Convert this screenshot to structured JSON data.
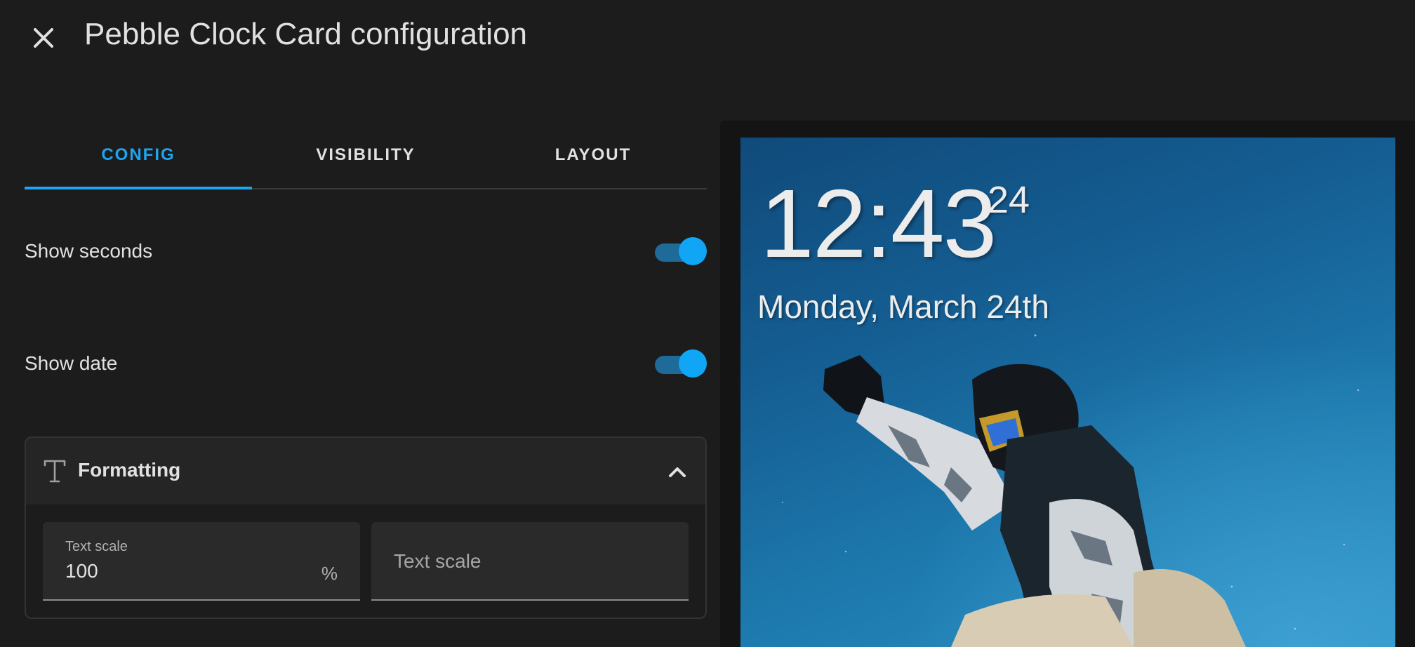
{
  "dialog": {
    "title": "Pebble Clock Card configuration",
    "close_icon": "close-icon"
  },
  "tabs": [
    {
      "label": "CONFIG",
      "active": true
    },
    {
      "label": "VISIBILITY",
      "active": false
    },
    {
      "label": "LAYOUT",
      "active": false
    }
  ],
  "settings": {
    "show_seconds": {
      "label": "Show seconds",
      "enabled": true
    },
    "show_date": {
      "label": "Show date",
      "enabled": true
    }
  },
  "formatting": {
    "title": "Formatting",
    "icon": "text-format-icon",
    "expanded": true,
    "text_scale": {
      "label": "Text scale",
      "value": "100",
      "suffix": "%"
    },
    "text_scale_secondary": {
      "placeholder": "Text scale"
    }
  },
  "preview": {
    "time": "12:43",
    "seconds": "24",
    "date": "Monday, March 24th"
  },
  "colors": {
    "accent": "#1ea4f0",
    "switch_thumb": "#10a6f5",
    "switch_track": "#1e6a98",
    "background": "#1c1c1c"
  }
}
